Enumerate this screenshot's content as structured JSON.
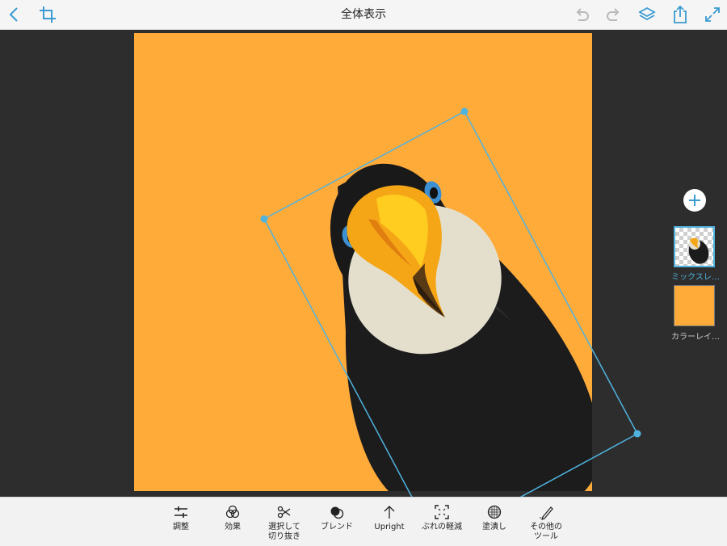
{
  "header": {
    "title": "全体表示"
  },
  "layers": [
    {
      "label": "ミックスレ…",
      "selected": true
    },
    {
      "label": "カラーレイ…",
      "selected": false,
      "fill": "#ffab3a"
    }
  ],
  "toolbar": {
    "tools": [
      {
        "name": "adjust",
        "label": "調整"
      },
      {
        "name": "effects",
        "label": "効果"
      },
      {
        "name": "select-cut",
        "label": "選択して\n切り抜き"
      },
      {
        "name": "blend",
        "label": "ブレンド"
      },
      {
        "name": "upright",
        "label": "Upright"
      },
      {
        "name": "shake-reduction",
        "label": "ぶれの軽減"
      },
      {
        "name": "fill",
        "label": "塗潰し"
      },
      {
        "name": "other-tools",
        "label": "その他の\nツール"
      }
    ]
  },
  "colors": {
    "accent": "#4fb3de",
    "canvas_background": "#ffab3a",
    "workspace": "#2d2d2d"
  }
}
